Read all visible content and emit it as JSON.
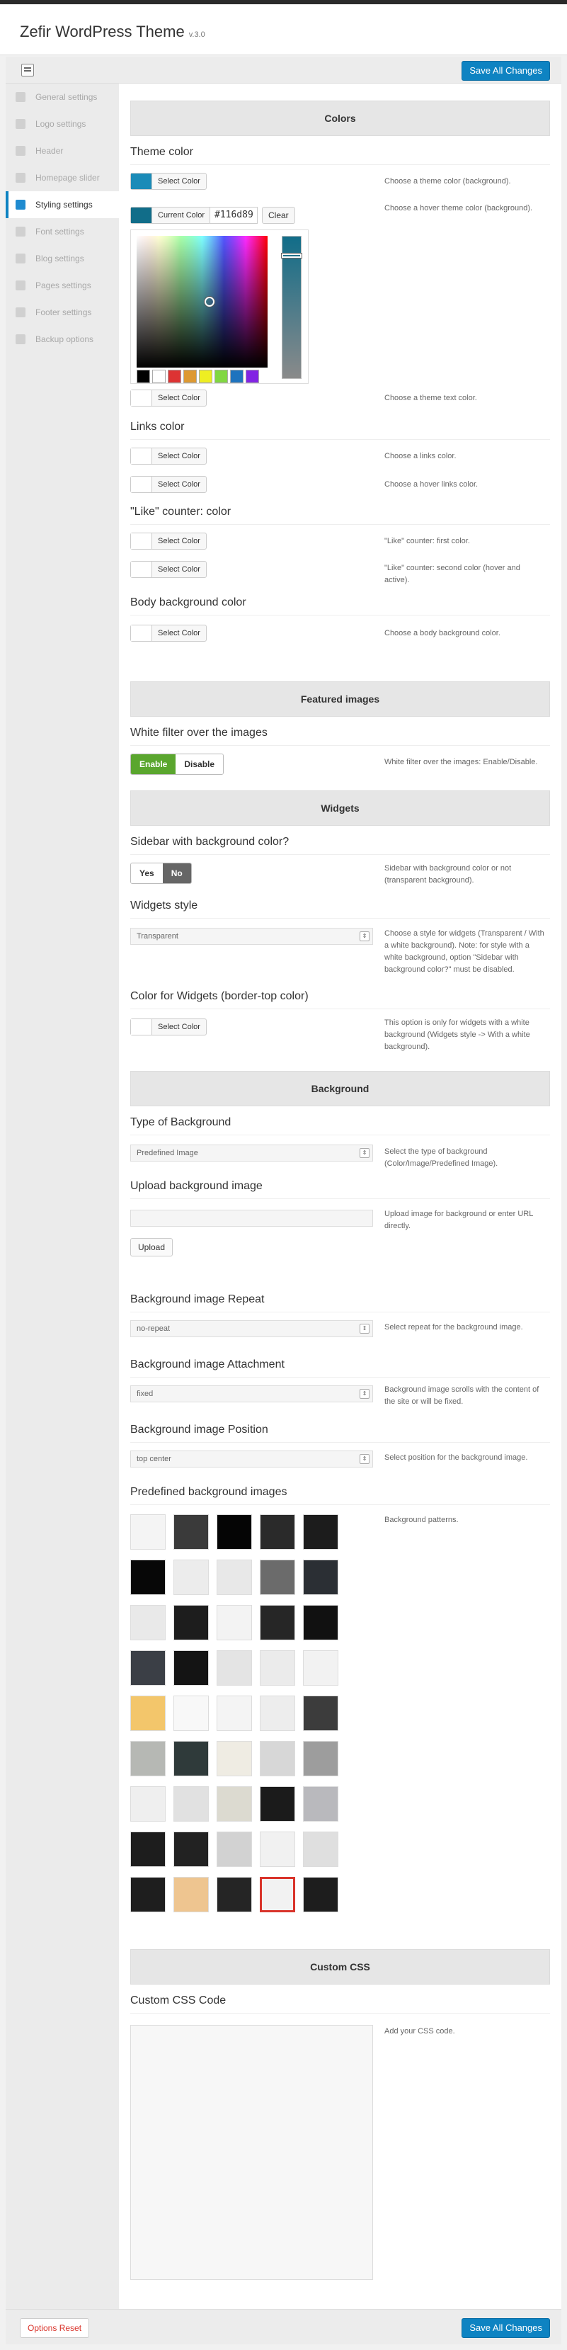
{
  "header": {
    "title": "Zefir WordPress Theme",
    "version": "v.3.0"
  },
  "toolbar": {
    "save_label": "Save All Changes"
  },
  "sidebar": {
    "items": [
      {
        "label": "General settings"
      },
      {
        "label": "Logo settings"
      },
      {
        "label": "Header"
      },
      {
        "label": "Homepage slider"
      },
      {
        "label": "Styling settings"
      },
      {
        "label": "Font settings"
      },
      {
        "label": "Blog settings"
      },
      {
        "label": "Pages settings"
      },
      {
        "label": "Footer settings"
      },
      {
        "label": "Backup options"
      }
    ]
  },
  "colors": {
    "heading": "Colors",
    "theme_color_label": "Theme color",
    "select_color": "Select Color",
    "current_color": "Current Color",
    "hex_value": "#116d89",
    "clear": "Clear",
    "desc_theme": "Choose a theme color (background).",
    "desc_hover": "Choose a hover theme color (background).",
    "desc_text": "Choose a theme text color.",
    "links_label": "Links color",
    "desc_links": "Choose a links color.",
    "desc_links_hover": "Choose a hover links color.",
    "like_label": "\"Like\" counter: color",
    "desc_like1": "\"Like\" counter: first color.",
    "desc_like2": "\"Like\" counter: second color (hover and active).",
    "body_label": "Body background color",
    "desc_body": "Choose a body background color.",
    "swatch_theme": "#1a8bb8",
    "swatch_current": "#116d89",
    "palette": [
      "#000000",
      "#ffffff",
      "#dd3333",
      "#dd9933",
      "#eeee22",
      "#81d742",
      "#1e73be",
      "#8224e3"
    ]
  },
  "featured": {
    "heading": "Featured images",
    "label": "White filter over the images",
    "enable": "Enable",
    "disable": "Disable",
    "desc": "White filter over the images: Enable/Disable."
  },
  "widgets": {
    "heading": "Widgets",
    "sidebar_label": "Sidebar with background color?",
    "yes": "Yes",
    "no": "No",
    "desc_sidebar": "Sidebar with background color or not (transparent background).",
    "style_label": "Widgets style",
    "style_value": "Transparent",
    "desc_style": "Choose a style for widgets (Transparent / With a white background). Note: for style with a white background, option \"Sidebar with background color?\" must be disabled.",
    "border_label": "Color for Widgets (border-top color)",
    "desc_border": "This option is only for widgets with a white background (Widgets style -> With a white background)."
  },
  "background": {
    "heading": "Background",
    "type_label": "Type of Background",
    "type_value": "Predefined Image",
    "desc_type": "Select the type of background (Color/Image/Predefined Image).",
    "upload_label": "Upload background image",
    "upload_btn": "Upload",
    "desc_upload": "Upload image for background or enter URL directly.",
    "repeat_label": "Background image Repeat",
    "repeat_value": "no-repeat",
    "desc_repeat": "Select repeat for the background image.",
    "attach_label": "Background image Attachment",
    "attach_value": "fixed",
    "desc_attach": "Background image scrolls with the content of the site or will be fixed.",
    "position_label": "Background image Position",
    "position_value": "top center",
    "desc_position": "Select position for the background image.",
    "patterns_label": "Predefined background images",
    "desc_patterns": "Background patterns.",
    "patterns": [
      "#f4f4f4",
      "#3a3a3a",
      "#050505",
      "#2a2a2a",
      "#1c1c1c",
      "#070707",
      "#ececec",
      "#e8e8e8",
      "#6b6b6b",
      "#2b2f34",
      "#e9e9e9",
      "#1d1d1d",
      "#f3f3f3",
      "#262626",
      "#111111",
      "#3b3f46",
      "#141414",
      "#e4e4e4",
      "#ebebeb",
      "#f2f2f2",
      "#f3c66b",
      "#f8f8f8",
      "#f4f4f4",
      "#ededed",
      "#3c3c3c",
      "#b6b8b4",
      "#2f3a3a",
      "#efece3",
      "#d7d7d7",
      "#9d9d9d",
      "#efefef",
      "#e1e1e1",
      "#dcdad0",
      "#1b1b1b",
      "#b9b9bd",
      "#1d1d1d",
      "#222222",
      "#d2d2d2",
      "#f1f1f1",
      "#dfdfdf",
      "#1e1e1e",
      "#eec590",
      "#252525",
      "#f2f2f2",
      "#1d1d1d"
    ],
    "selected_index": 43
  },
  "custom_css": {
    "heading": "Custom CSS",
    "label": "Custom CSS Code",
    "desc": "Add your CSS code."
  },
  "footer": {
    "reset_label": "Options Reset",
    "save_label": "Save All Changes"
  }
}
